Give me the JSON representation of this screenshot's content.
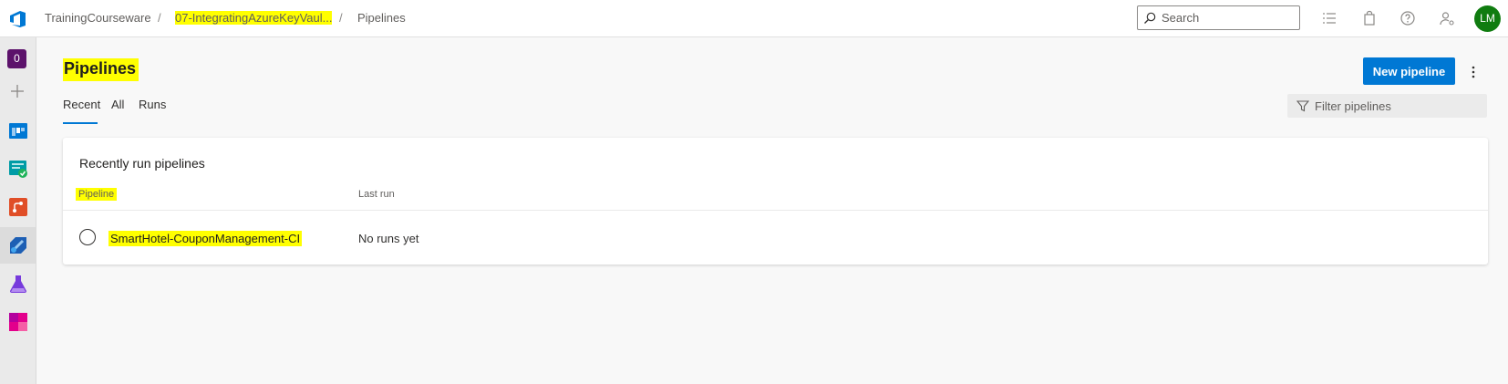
{
  "header": {
    "breadcrumbs": [
      {
        "label": "TrainingCourseware"
      },
      {
        "label": "07-IntegratingAzureKeyVaul..."
      },
      {
        "label": "Pipelines"
      }
    ],
    "separator": "/",
    "search_placeholder": "Search",
    "avatar_initials": "LM",
    "icons": [
      "azure-devops-logo-icon",
      "checklist-icon",
      "shopping-bag-icon",
      "help-icon",
      "user-settings-icon"
    ]
  },
  "rail": {
    "org_badge": "0",
    "items": [
      {
        "icon": "add-icon"
      },
      {
        "icon": "boards-icon"
      },
      {
        "icon": "test-plans-icon"
      },
      {
        "icon": "repos-icon"
      },
      {
        "icon": "pipelines-icon",
        "active": true
      },
      {
        "icon": "test-flask-icon"
      },
      {
        "icon": "artifacts-icon"
      }
    ]
  },
  "page": {
    "title": "Pipelines",
    "tabs": [
      {
        "label": "Recent",
        "selected": true
      },
      {
        "label": "All"
      },
      {
        "label": "Runs"
      }
    ],
    "new_button": "New pipeline",
    "filter_placeholder": "Filter pipelines"
  },
  "card": {
    "title": "Recently run pipelines",
    "columns": [
      "Pipeline",
      "Last run"
    ],
    "rows": [
      {
        "name": "SmartHotel-CouponManagement-CI",
        "last_run": "No runs yet"
      }
    ]
  },
  "colors": {
    "accent": "#0078d4",
    "highlight": "#ffff00",
    "avatar": "#107c10"
  }
}
